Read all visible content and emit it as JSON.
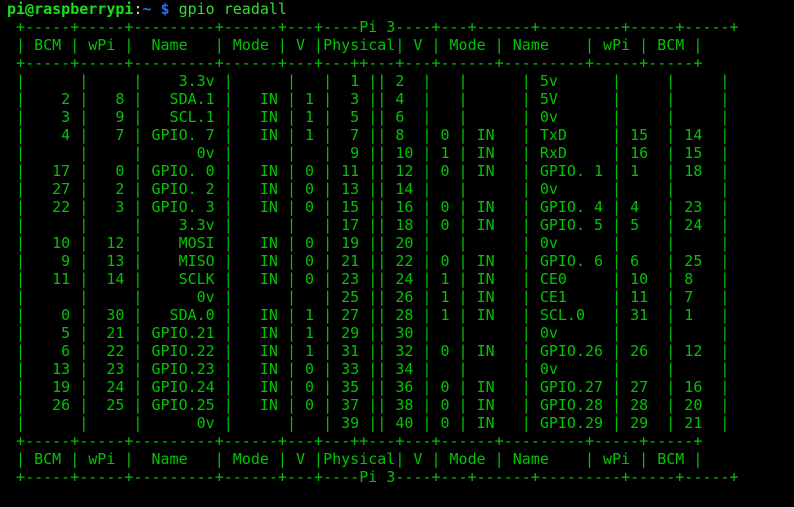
{
  "terminal": {
    "window_title": "pi@raspberrypi: ~",
    "colors": {
      "background": "#000000",
      "table_green": "#00c400",
      "prompt_green": "#18e018",
      "command_green": "#2ee02e",
      "prompt_blue": "#2b6df0",
      "punct_white": "#d8d8d8"
    }
  },
  "prompt": {
    "user_host": "pi@raspberrypi",
    "punct": ":",
    "path": "~",
    "dollar": "$",
    "command": "gpio readall"
  },
  "table": {
    "board_label": "Pi 3",
    "header_cells": [
      "BCM",
      "wPi",
      "Name",
      "Mode",
      "V",
      "Physical",
      "V",
      "Mode",
      "Name",
      "wPi",
      "BCM"
    ],
    "separator_top": " +-----+-----+---------+------+---+---Pi 3---+---+------+---------+-----+-----+",
    "header_row": " | BCM | wPi |   Name  | Mode | V | Physical | V | Mode | Name    | wPi | BCM |",
    "separator_mid": " +-----+-----+---------+------+---+----++----+---+------+---------+-----+-----+",
    "separator_bottom": " +-----+-----+---------+------+---+----++----+---+------+---------+-----+-----+",
    "footer_row": " | BCM | wPi |   Name  | Mode | V | Physical | V | Mode | Name    | wPi | BCM |",
    "separator_footer": " +-----+-----+---------+------+---+---Pi 3---+---+------+---------+-----+-----+",
    "rows": [
      {
        "bcm_l": "",
        "wpi_l": "",
        "name_l": "3.3v",
        "mode_l": "",
        "v_l": "",
        "phys_l": "1",
        "phys_r": "2",
        "v_r": "",
        "mode_r": "",
        "name_r": "5v",
        "wpi_r": "",
        "bcm_r": ""
      },
      {
        "bcm_l": "2",
        "wpi_l": "8",
        "name_l": "SDA.1",
        "mode_l": "IN",
        "v_l": "1",
        "phys_l": "3",
        "phys_r": "4",
        "v_r": "",
        "mode_r": "",
        "name_r": "5V",
        "wpi_r": "",
        "bcm_r": ""
      },
      {
        "bcm_l": "3",
        "wpi_l": "9",
        "name_l": "SCL.1",
        "mode_l": "IN",
        "v_l": "1",
        "phys_l": "5",
        "phys_r": "6",
        "v_r": "",
        "mode_r": "",
        "name_r": "0v",
        "wpi_r": "",
        "bcm_r": ""
      },
      {
        "bcm_l": "4",
        "wpi_l": "7",
        "name_l": "GPIO. 7",
        "mode_l": "IN",
        "v_l": "1",
        "phys_l": "7",
        "phys_r": "8",
        "v_r": "0",
        "mode_r": "IN",
        "name_r": "TxD",
        "wpi_r": "15",
        "bcm_r": "14"
      },
      {
        "bcm_l": "",
        "wpi_l": "",
        "name_l": "0v",
        "mode_l": "",
        "v_l": "",
        "phys_l": "9",
        "phys_r": "10",
        "v_r": "1",
        "mode_r": "IN",
        "name_r": "RxD",
        "wpi_r": "16",
        "bcm_r": "15"
      },
      {
        "bcm_l": "17",
        "wpi_l": "0",
        "name_l": "GPIO. 0",
        "mode_l": "IN",
        "v_l": "0",
        "phys_l": "11",
        "phys_r": "12",
        "v_r": "0",
        "mode_r": "IN",
        "name_r": "GPIO. 1",
        "wpi_r": "1",
        "bcm_r": "18"
      },
      {
        "bcm_l": "27",
        "wpi_l": "2",
        "name_l": "GPIO. 2",
        "mode_l": "IN",
        "v_l": "0",
        "phys_l": "13",
        "phys_r": "14",
        "v_r": "",
        "mode_r": "",
        "name_r": "0v",
        "wpi_r": "",
        "bcm_r": ""
      },
      {
        "bcm_l": "22",
        "wpi_l": "3",
        "name_l": "GPIO. 3",
        "mode_l": "IN",
        "v_l": "0",
        "phys_l": "15",
        "phys_r": "16",
        "v_r": "0",
        "mode_r": "IN",
        "name_r": "GPIO. 4",
        "wpi_r": "4",
        "bcm_r": "23"
      },
      {
        "bcm_l": "",
        "wpi_l": "",
        "name_l": "3.3v",
        "mode_l": "",
        "v_l": "",
        "phys_l": "17",
        "phys_r": "18",
        "v_r": "0",
        "mode_r": "IN",
        "name_r": "GPIO. 5",
        "wpi_r": "5",
        "bcm_r": "24"
      },
      {
        "bcm_l": "10",
        "wpi_l": "12",
        "name_l": "MOSI",
        "mode_l": "IN",
        "v_l": "0",
        "phys_l": "19",
        "phys_r": "20",
        "v_r": "",
        "mode_r": "",
        "name_r": "0v",
        "wpi_r": "",
        "bcm_r": ""
      },
      {
        "bcm_l": "9",
        "wpi_l": "13",
        "name_l": "MISO",
        "mode_l": "IN",
        "v_l": "0",
        "phys_l": "21",
        "phys_r": "22",
        "v_r": "0",
        "mode_r": "IN",
        "name_r": "GPIO. 6",
        "wpi_r": "6",
        "bcm_r": "25"
      },
      {
        "bcm_l": "11",
        "wpi_l": "14",
        "name_l": "SCLK",
        "mode_l": "IN",
        "v_l": "0",
        "phys_l": "23",
        "phys_r": "24",
        "v_r": "1",
        "mode_r": "IN",
        "name_r": "CE0",
        "wpi_r": "10",
        "bcm_r": "8"
      },
      {
        "bcm_l": "",
        "wpi_l": "",
        "name_l": "0v",
        "mode_l": "",
        "v_l": "",
        "phys_l": "25",
        "phys_r": "26",
        "v_r": "1",
        "mode_r": "IN",
        "name_r": "CE1",
        "wpi_r": "11",
        "bcm_r": "7"
      },
      {
        "bcm_l": "0",
        "wpi_l": "30",
        "name_l": "SDA.0",
        "mode_l": "IN",
        "v_l": "1",
        "phys_l": "27",
        "phys_r": "28",
        "v_r": "1",
        "mode_r": "IN",
        "name_r": "SCL.0",
        "wpi_r": "31",
        "bcm_r": "1"
      },
      {
        "bcm_l": "5",
        "wpi_l": "21",
        "name_l": "GPIO.21",
        "mode_l": "IN",
        "v_l": "1",
        "phys_l": "29",
        "phys_r": "30",
        "v_r": "",
        "mode_r": "",
        "name_r": "0v",
        "wpi_r": "",
        "bcm_r": ""
      },
      {
        "bcm_l": "6",
        "wpi_l": "22",
        "name_l": "GPIO.22",
        "mode_l": "IN",
        "v_l": "1",
        "phys_l": "31",
        "phys_r": "32",
        "v_r": "0",
        "mode_r": "IN",
        "name_r": "GPIO.26",
        "wpi_r": "26",
        "bcm_r": "12"
      },
      {
        "bcm_l": "13",
        "wpi_l": "23",
        "name_l": "GPIO.23",
        "mode_l": "IN",
        "v_l": "0",
        "phys_l": "33",
        "phys_r": "34",
        "v_r": "",
        "mode_r": "",
        "name_r": "0v",
        "wpi_r": "",
        "bcm_r": ""
      },
      {
        "bcm_l": "19",
        "wpi_l": "24",
        "name_l": "GPIO.24",
        "mode_l": "IN",
        "v_l": "0",
        "phys_l": "35",
        "phys_r": "36",
        "v_r": "0",
        "mode_r": "IN",
        "name_r": "GPIO.27",
        "wpi_r": "27",
        "bcm_r": "16"
      },
      {
        "bcm_l": "26",
        "wpi_l": "25",
        "name_l": "GPIO.25",
        "mode_l": "IN",
        "v_l": "0",
        "phys_l": "37",
        "phys_r": "38",
        "v_r": "0",
        "mode_r": "IN",
        "name_r": "GPIO.28",
        "wpi_r": "28",
        "bcm_r": "20"
      },
      {
        "bcm_l": "",
        "wpi_l": "",
        "name_l": "0v",
        "mode_l": "",
        "v_l": "",
        "phys_l": "39",
        "phys_r": "40",
        "v_r": "0",
        "mode_r": "IN",
        "name_r": "GPIO.29",
        "wpi_r": "29",
        "bcm_r": "21"
      }
    ]
  }
}
